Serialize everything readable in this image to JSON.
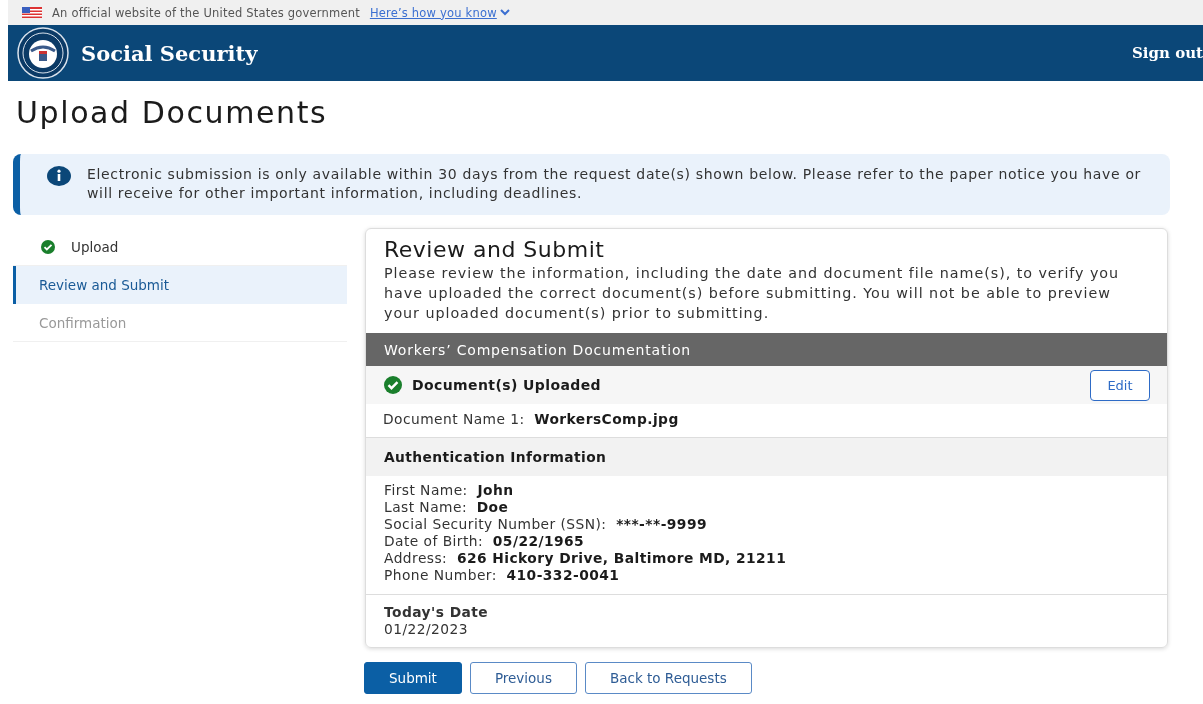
{
  "gov_banner": {
    "text": "An official website of the United States government",
    "link": "Here’s how you know"
  },
  "header": {
    "title": "Social Security",
    "sign_out": "Sign out"
  },
  "page_title": "Upload Documents",
  "alert": {
    "text": "Electronic submission is only available within 30 days from the request date(s) shown below. Please refer to the paper notice you have or will receive for other important information, including deadlines."
  },
  "steps": [
    {
      "label": "Upload",
      "completed": true,
      "selected": false
    },
    {
      "label": "Review and Submit",
      "completed": false,
      "selected": true
    },
    {
      "label": "Confirmation",
      "completed": false,
      "selected": false
    }
  ],
  "review": {
    "title": "Review and Submit",
    "intro": "Please review the information, including the date and document file name(s), to verify you have uploaded the correct document(s) before submitting. You will not be able to preview your uploaded document(s) prior to submitting.",
    "section_title": "Workers’ Compensation Documentation",
    "upload_status": {
      "label": "Document(s) Uploaded",
      "uploaded": true,
      "edit": "Edit"
    },
    "documents": [
      {
        "label": "Document Name 1:",
        "value": "WorkersComp.jpg"
      }
    ],
    "auth_title": "Authentication Information",
    "auth_fields": [
      {
        "label": "First Name:",
        "value": "John"
      },
      {
        "label": "Last Name:",
        "value": "Doe"
      },
      {
        "label": "Social Security Number (SSN):",
        "value": "***-**-9999"
      },
      {
        "label": "Date of Birth:",
        "value": "05/22/1965"
      },
      {
        "label": "Address:",
        "value": "626 Hickory Drive, Baltimore MD, 21211"
      },
      {
        "label": "Phone Number:",
        "value": "410-332-0041"
      }
    ],
    "date_title": "Today's Date",
    "date_value": "01/22/2023"
  },
  "buttons": [
    {
      "label": "Submit",
      "kind": "primary"
    },
    {
      "label": "Previous",
      "kind": "outline"
    },
    {
      "label": "Back to Requests",
      "kind": "outline"
    }
  ]
}
